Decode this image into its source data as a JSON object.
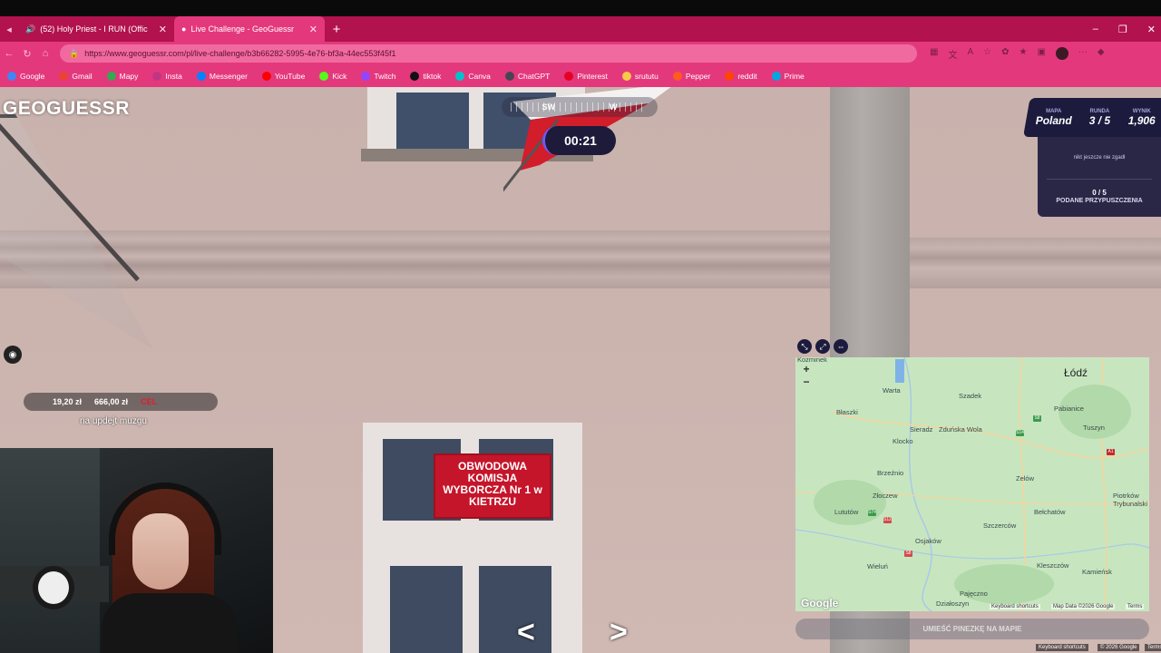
{
  "browser": {
    "tabs": [
      {
        "label": "(52) Holy Priest - I RUN (Offic",
        "icon": "youtube-icon",
        "active": false
      },
      {
        "label": "Live Challenge - GeoGuessr",
        "icon": "pin-icon",
        "active": true
      }
    ],
    "new_tab": "+",
    "url": "https://www.geoguessr.com/pl/live-challenge/b3b66282-5995-4e76-bf3a-44ec553f45f1",
    "window_controls": [
      "–",
      "❐",
      "✕"
    ],
    "bookmarks": [
      {
        "label": "Google",
        "color": "#4285f4"
      },
      {
        "label": "Gmail",
        "color": "#ea4335"
      },
      {
        "label": "Mapy",
        "color": "#34a853"
      },
      {
        "label": "Insta",
        "color": "#c13584"
      },
      {
        "label": "Messenger",
        "color": "#0084ff"
      },
      {
        "label": "YouTube",
        "color": "#ff0000"
      },
      {
        "label": "Kick",
        "color": "#53fc18"
      },
      {
        "label": "Twitch",
        "color": "#9146ff"
      },
      {
        "label": "tiktok",
        "color": "#111111"
      },
      {
        "label": "Canva",
        "color": "#00c4cc"
      },
      {
        "label": "ChatGPT",
        "color": "#444654"
      },
      {
        "label": "Pinterest",
        "color": "#e60023"
      },
      {
        "label": "srututu",
        "color": "#f7c948"
      },
      {
        "label": "Pepper",
        "color": "#ff5a1f"
      },
      {
        "label": "reddit",
        "color": "#ff4500"
      },
      {
        "label": "Prime",
        "color": "#00a8e1"
      }
    ]
  },
  "game": {
    "logo": "GEOGUESSR",
    "compass": {
      "left": "SW",
      "right": "W"
    },
    "timer": "00:21",
    "score": {
      "map_label": "MAPA",
      "map_value": "Poland",
      "round_label": "RUNDA",
      "round_value": "3 / 5",
      "score_label": "WYNIK",
      "score_value": "1,906"
    },
    "guesses": {
      "nobody_text": "nikt jeszcze nie zgadł",
      "count": "0 / 5",
      "label": "PODANE PRZYPUSZCZENIA"
    },
    "sign_text": "OBWODOWA KOMISJA WYBORCZA Nr 1 w KIETRZU",
    "place_button": "UMIEŚĆ PINEZKĘ NA MAPIE",
    "footer": {
      "shortcuts": "Keyboard shortcuts",
      "copyright": "© 2026 Google",
      "terms": "Terms"
    }
  },
  "map": {
    "zoom_in": "+",
    "zoom_out": "−",
    "big_city": "Łódź",
    "cities": [
      {
        "name": "Warta"
      },
      {
        "name": "Szadek"
      },
      {
        "name": "Pabianice"
      },
      {
        "name": "Błaszki"
      },
      {
        "name": "Sieradz"
      },
      {
        "name": "Zduńska Wola"
      },
      {
        "name": "Tuszyn"
      },
      {
        "name": "Klocko"
      },
      {
        "name": "Brzeźnio"
      },
      {
        "name": "Zelów"
      },
      {
        "name": "Złoczew"
      },
      {
        "name": "Piotrków Trybunalski"
      },
      {
        "name": "Lututów"
      },
      {
        "name": "Bełchatów"
      },
      {
        "name": "Szczerców"
      },
      {
        "name": "Osjaków"
      },
      {
        "name": "Wieluń"
      },
      {
        "name": "Kleszczów"
      },
      {
        "name": "Kamieńsk"
      },
      {
        "name": "Pajęczno"
      },
      {
        "name": "Działoszyn"
      },
      {
        "name": "Kozminek"
      }
    ],
    "road_labels": [
      "S8",
      "S14",
      "A1",
      "S74",
      "S12",
      "S8"
    ],
    "logo": "Google",
    "shortcuts": "Keyboard shortcuts",
    "map_data": "Map Data ©2026 Google",
    "terms": "Terms"
  },
  "stream": {
    "donation_a": "19,20 zł",
    "donation_b": "666,00 zł",
    "donation_c": "CEL",
    "chat_message": "na updejt muzgu"
  }
}
